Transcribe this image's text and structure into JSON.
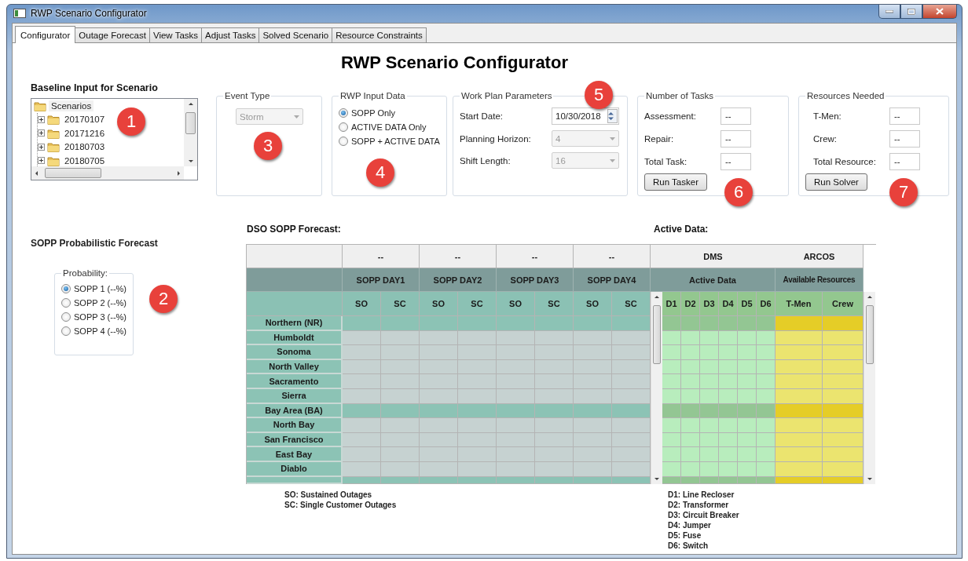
{
  "window": {
    "title": "RWP Scenario Configurator"
  },
  "tabs": [
    {
      "label": "Configurator",
      "selected": true
    },
    {
      "label": "Outage Forecast",
      "selected": false
    },
    {
      "label": "View Tasks",
      "selected": false
    },
    {
      "label": "Adjust Tasks",
      "selected": false
    },
    {
      "label": "Solved Scenario",
      "selected": false
    },
    {
      "label": "Resource Constraints",
      "selected": false
    }
  ],
  "heading": "RWP Scenario Configurator",
  "baseline": {
    "title": "Baseline Input for Scenario",
    "tree": [
      {
        "label": "Scenarios",
        "children": [
          {
            "label": "20170107",
            "expanded": false
          },
          {
            "label": "20171216",
            "expanded": false
          },
          {
            "label": "20180703",
            "expanded": false
          },
          {
            "label": "20180705",
            "expanded": false
          }
        ]
      }
    ]
  },
  "event_type": {
    "title": "Event Type",
    "dropdown": {
      "value": "Storm",
      "disabled": true
    }
  },
  "rwp_input": {
    "title": "RWP Input Data",
    "options": [
      {
        "label": "SOPP Only",
        "selected": true
      },
      {
        "label": "ACTIVE DATA Only",
        "selected": false
      },
      {
        "label": "SOPP + ACTIVE DATA",
        "selected": false
      }
    ]
  },
  "work_plan": {
    "title": "Work Plan Parameters",
    "fields": [
      {
        "kind": "date",
        "label": "Start Date:",
        "value": "10/30/2018",
        "disabled": false
      },
      {
        "kind": "dropdown",
        "label": "Planning Horizon:",
        "value": "4",
        "disabled": true
      },
      {
        "kind": "dropdown",
        "label": "Shift Length:",
        "value": "16",
        "disabled": true
      }
    ]
  },
  "tasks": {
    "title": "Number of Tasks",
    "fields": [
      {
        "label": "Assessment:",
        "value": "--"
      },
      {
        "label": "Repair:",
        "value": "--"
      },
      {
        "label": "Total Task:",
        "value": "--"
      }
    ],
    "button": "Run Tasker"
  },
  "resources": {
    "title": "Resources Needed",
    "fields": [
      {
        "label": "T-Men:",
        "value": "--"
      },
      {
        "label": "Crew:",
        "value": "--"
      },
      {
        "label": "Total Resource:",
        "value": "--"
      }
    ],
    "button": "Run Solver"
  },
  "probabilistic": {
    "title": "SOPP Probabilistic Forecast",
    "group": "Probability:",
    "options": [
      {
        "label": "SOPP 1 (--%)",
        "selected": true
      },
      {
        "label": "SOPP 2 (--%)",
        "selected": false
      },
      {
        "label": "SOPP 3 (--%)",
        "selected": false
      },
      {
        "label": "SOPP 4 (--%)",
        "selected": false
      }
    ]
  },
  "forecast_title": "DSO SOPP Forecast:",
  "active_title": "Active Data:",
  "table": {
    "group_headers": [
      "--",
      "--",
      "--",
      "--"
    ],
    "sources": [
      "DMS",
      "ARCOS"
    ],
    "day_headers": [
      "SOPP DAY1",
      "SOPP DAY2",
      "SOPP DAY3",
      "SOPP DAY4"
    ],
    "active_header": "Active Data",
    "resources_header": "Available Resources",
    "sub_columns": [
      "SO",
      "SC",
      "SO",
      "SC",
      "SO",
      "SC",
      "SO",
      "SC"
    ],
    "device_columns": [
      "D1",
      "D2",
      "D3",
      "D4",
      "D5",
      "D6"
    ],
    "resource_columns": [
      "T-Men",
      "Crew"
    ],
    "rows": [
      {
        "label": "Northern (NR)",
        "kind": "group"
      },
      {
        "label": "Humboldt",
        "kind": "region"
      },
      {
        "label": "Sonoma",
        "kind": "region"
      },
      {
        "label": "North Valley",
        "kind": "region"
      },
      {
        "label": "Sacramento",
        "kind": "region"
      },
      {
        "label": "Sierra",
        "kind": "region"
      },
      {
        "label": "Bay Area (BA)",
        "kind": "group"
      },
      {
        "label": "North Bay",
        "kind": "region"
      },
      {
        "label": "San Francisco",
        "kind": "region"
      },
      {
        "label": "East Bay",
        "kind": "region"
      },
      {
        "label": "Diablo",
        "kind": "region"
      },
      {
        "kind": "group"
      }
    ]
  },
  "legend_left": [
    "SO: Sustained Outages",
    "SC: Single Customer Outages"
  ],
  "legend_right": [
    "D1: Line Recloser",
    "D2: Transformer",
    "D3: Circuit Breaker",
    "D4: Jumper",
    "D5: Fuse",
    "D6: Switch"
  ],
  "callouts": [
    "1",
    "2",
    "3",
    "4",
    "5",
    "6",
    "7"
  ]
}
